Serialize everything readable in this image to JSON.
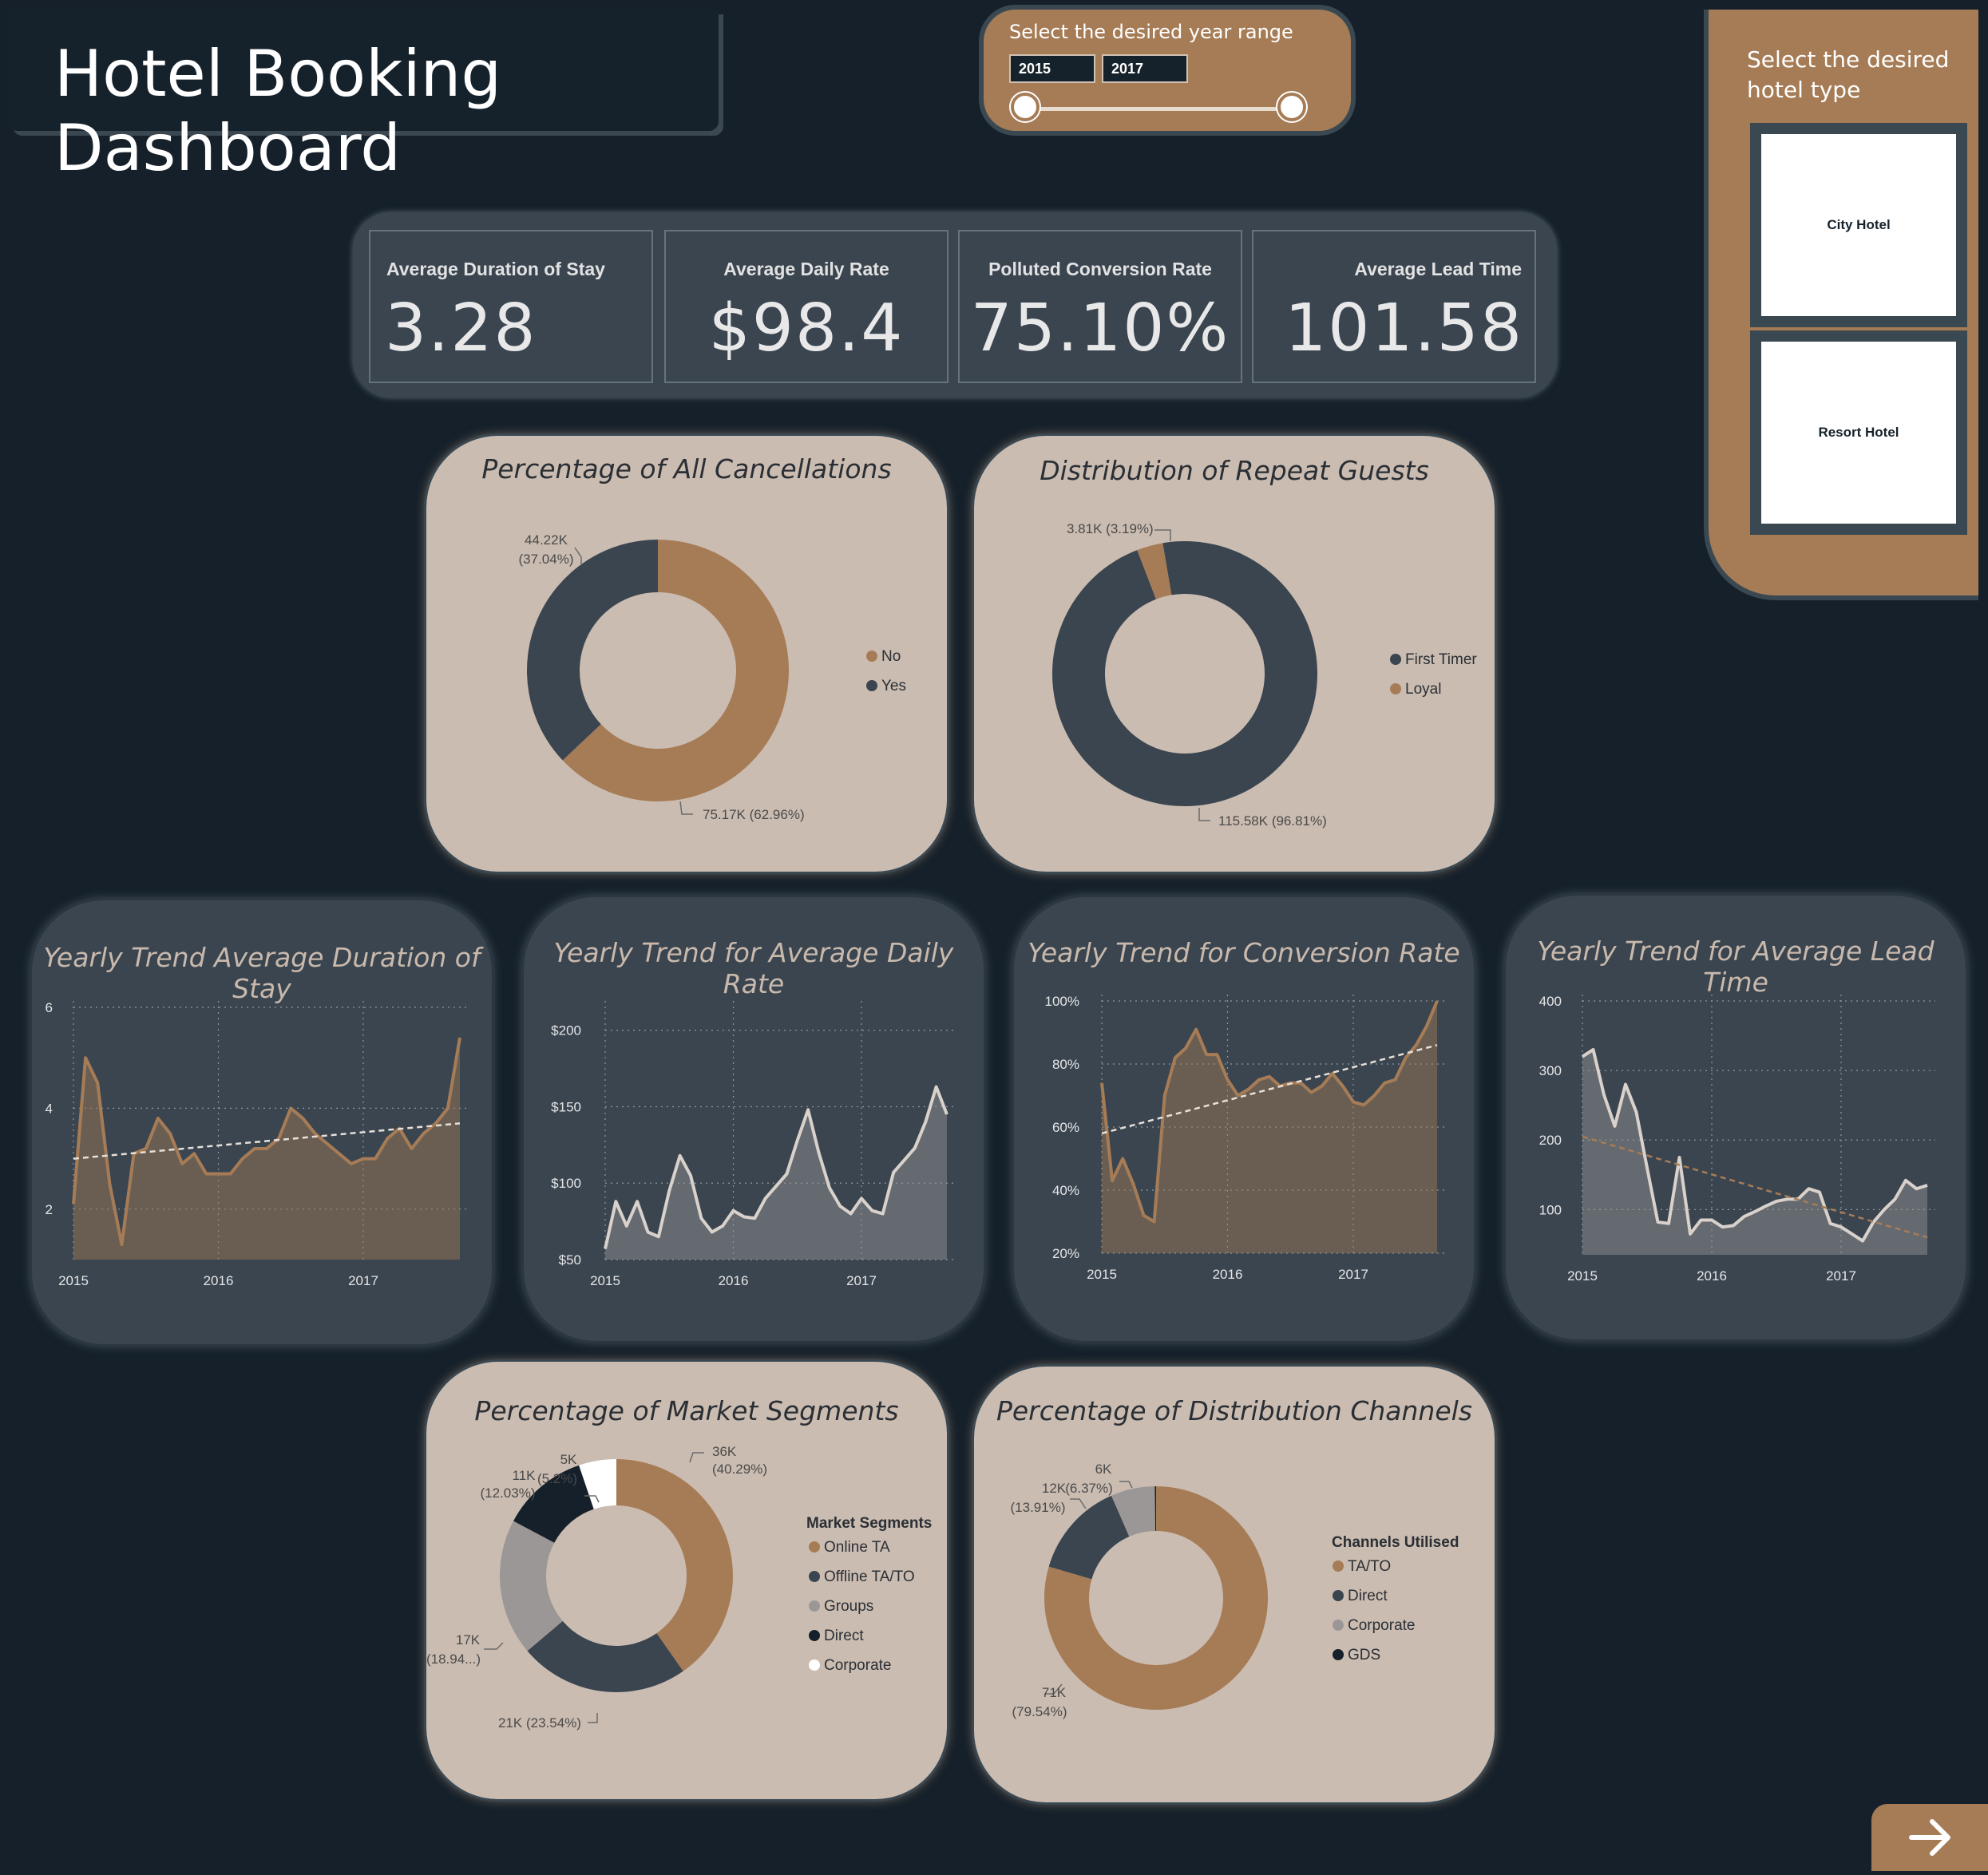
{
  "header": {
    "title": "Hotel Booking Dashboard"
  },
  "year_range": {
    "label": "Select the desired year range",
    "start": "2015",
    "end": "2017"
  },
  "hotel_type": {
    "label": "Select the desired hotel type",
    "options": [
      "City Hotel",
      "Resort Hotel"
    ]
  },
  "kpis": [
    {
      "label": "Average Duration of Stay",
      "value": "3.28"
    },
    {
      "label": "Average Daily Rate",
      "value": "$98.4"
    },
    {
      "label": "Polluted Conversion Rate",
      "value": "75.10%"
    },
    {
      "label": "Average Lead Time",
      "value": "101.58"
    }
  ],
  "colors": {
    "bg": "#15202a",
    "brown": "#a67c56",
    "slate": "#3a4550",
    "beige": "#cbbcb1",
    "grey": "#9b9797"
  },
  "icons": {
    "next": "arrow-right-icon"
  },
  "chart_data": [
    {
      "type": "pie",
      "title": "Percentage of All Cancellations",
      "slices": [
        {
          "name": "No",
          "value": 75.17,
          "label_value": "75.17K",
          "label_pct": "(62.96%)",
          "color": "#a67c56"
        },
        {
          "name": "Yes",
          "value": 44.22,
          "label_value": "44.22K",
          "label_pct": "(37.04%)",
          "color": "#3a4550"
        }
      ],
      "legend": [
        "No",
        "Yes"
      ]
    },
    {
      "type": "pie",
      "title": "Distribution of Repeat Guests",
      "slices": [
        {
          "name": "First Timer",
          "value": 115.58,
          "label_value": "115.58K",
          "label_pct": "(96.81%)",
          "color": "#3a4550"
        },
        {
          "name": "Loyal",
          "value": 3.81,
          "label_value": "3.81K",
          "label_pct": "(3.19%)",
          "color": "#a67c56"
        }
      ],
      "legend": [
        "First Timer",
        "Loyal"
      ]
    },
    {
      "type": "area",
      "title": "Yearly Trend Average Duration of Stay",
      "x_ticks": [
        "2015",
        "2016",
        "2017"
      ],
      "y_ticks": [
        "2",
        "4",
        "6"
      ],
      "ylim": [
        1,
        6
      ],
      "values": [
        2.1,
        5.0,
        4.5,
        2.5,
        1.3,
        3.1,
        3.2,
        3.8,
        3.5,
        2.9,
        3.1,
        2.7,
        2.7,
        2.7,
        3.0,
        3.2,
        3.2,
        3.4,
        4.0,
        3.8,
        3.5,
        3.3,
        3.1,
        2.9,
        3.0,
        3.0,
        3.4,
        3.6,
        3.2,
        3.5,
        3.7,
        4.0,
        5.4
      ],
      "trend": [
        3.0,
        3.7
      ],
      "color": "#a67c56"
    },
    {
      "type": "area",
      "title": "Yearly Trend for Average Daily Rate",
      "x_ticks": [
        "2015",
        "2016",
        "2017"
      ],
      "y_ticks": [
        "$50",
        "$100",
        "$150",
        "$200"
      ],
      "ylim": [
        50,
        215
      ],
      "values": [
        57,
        88,
        72,
        88,
        68,
        65,
        95,
        118,
        105,
        77,
        68,
        72,
        82,
        78,
        77,
        90,
        98,
        106,
        128,
        148,
        120,
        97,
        85,
        80,
        90,
        82,
        80,
        107,
        115,
        123,
        140,
        163,
        145
      ],
      "color": "#9b9797"
    },
    {
      "type": "area",
      "title": "Yearly Trend for Conversion Rate",
      "x_ticks": [
        "2015",
        "2016",
        "2017"
      ],
      "y_ticks": [
        "20%",
        "40%",
        "60%",
        "80%",
        "100%"
      ],
      "ylim": [
        20,
        100
      ],
      "values": [
        74,
        43,
        50,
        42,
        32,
        30,
        70,
        82,
        85,
        91,
        83,
        83,
        75,
        70,
        72,
        75,
        76,
        73,
        74,
        74,
        71,
        73,
        77,
        73,
        68,
        67,
        70,
        74,
        75,
        82,
        86,
        92,
        100
      ],
      "trend": [
        58,
        86
      ],
      "color": "#a67c56"
    },
    {
      "type": "area",
      "title": "Yearly Trend for Average Lead Time",
      "x_ticks": [
        "2015",
        "2016",
        "2017"
      ],
      "y_ticks": [
        "100",
        "200",
        "300",
        "400"
      ],
      "ylim": [
        35,
        400
      ],
      "values": [
        320,
        330,
        265,
        220,
        280,
        240,
        160,
        82,
        80,
        175,
        65,
        85,
        85,
        75,
        77,
        90,
        97,
        105,
        112,
        115,
        115,
        130,
        125,
        80,
        75,
        65,
        55,
        82,
        100,
        115,
        142,
        130,
        135
      ],
      "trend": [
        205,
        60
      ],
      "color": "#9b9797"
    },
    {
      "type": "pie",
      "title": "Percentage of Market Segments",
      "legend_title": "Market Segments",
      "slices": [
        {
          "name": "Online TA",
          "value": 40.29,
          "label_value": "36K",
          "label_pct": "(40.29%)",
          "color": "#a67c56"
        },
        {
          "name": "Offline TA/TO",
          "value": 23.54,
          "label_value": "21K (23.54%)",
          "label_pct": "",
          "color": "#3a4550"
        },
        {
          "name": "Groups",
          "value": 18.94,
          "label_value": "17K",
          "label_pct": "(18.94...)",
          "color": "#9b9797"
        },
        {
          "name": "Direct",
          "value": 12.03,
          "label_value": "11K",
          "label_pct": "(12.03%)",
          "color": "#15202a"
        },
        {
          "name": "Corporate",
          "value": 5.2,
          "label_value": "5K",
          "label_pct": "(5.2%)",
          "color": "#ffffff"
        }
      ]
    },
    {
      "type": "pie",
      "title": "Percentage of Distribution Channels",
      "legend_title": "Channels Utilised",
      "slices": [
        {
          "name": "TA/TO",
          "value": 79.54,
          "label_value": "71K",
          "label_pct": "(79.54%)",
          "color": "#a67c56"
        },
        {
          "name": "Direct",
          "value": 13.91,
          "label_value": "12K",
          "label_pct": "(13.91%)",
          "color": "#3a4550"
        },
        {
          "name": "Corporate",
          "value": 6.37,
          "label_value": "6K",
          "label_pct": "(6.37%)",
          "color": "#9b9797"
        },
        {
          "name": "GDS",
          "value": 0.18,
          "label_value": "",
          "label_pct": "",
          "color": "#15202a"
        }
      ]
    }
  ]
}
